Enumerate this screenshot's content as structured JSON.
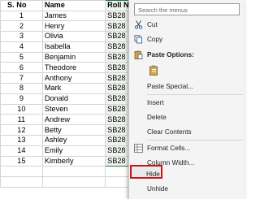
{
  "sheet": {
    "headers": {
      "sno": "S. No",
      "name": "Name",
      "roll": "Roll N"
    },
    "rows": [
      {
        "sno": "1",
        "name": "James",
        "roll": "SB28"
      },
      {
        "sno": "2",
        "name": "Henry",
        "roll": "SB28"
      },
      {
        "sno": "3",
        "name": "Olivia",
        "roll": "SB28"
      },
      {
        "sno": "4",
        "name": "Isabella",
        "roll": "SB28"
      },
      {
        "sno": "5",
        "name": "Benjamin",
        "roll": "SB28"
      },
      {
        "sno": "6",
        "name": "Theodore",
        "roll": "SB28"
      },
      {
        "sno": "7",
        "name": "Anthony",
        "roll": "SB28"
      },
      {
        "sno": "8",
        "name": "Mark",
        "roll": "SB28"
      },
      {
        "sno": "9",
        "name": "Donald",
        "roll": "SB28"
      },
      {
        "sno": "10",
        "name": "Steven",
        "roll": "SB28"
      },
      {
        "sno": "11",
        "name": "Andrew",
        "roll": "SB28"
      },
      {
        "sno": "12",
        "name": "Betty",
        "roll": "SB28"
      },
      {
        "sno": "13",
        "name": "Ashley",
        "roll": "SB28"
      },
      {
        "sno": "14",
        "name": "Emily",
        "roll": "SB28"
      },
      {
        "sno": "15",
        "name": "Kimberly",
        "roll": "SB28"
      }
    ]
  },
  "menu": {
    "search_placeholder": "Search the menus",
    "cut": "Cut",
    "copy": "Copy",
    "paste_options": "Paste Options:",
    "paste_special": "Paste Special...",
    "insert": "Insert",
    "delete": "Delete",
    "clear_contents": "Clear Contents",
    "format_cells": "Format Cells...",
    "column_width": "Column Width...",
    "hide": "Hide",
    "unhide": "Unhide"
  },
  "colors": {
    "selection_border": "#1e7145",
    "highlight": "#c4181b"
  }
}
